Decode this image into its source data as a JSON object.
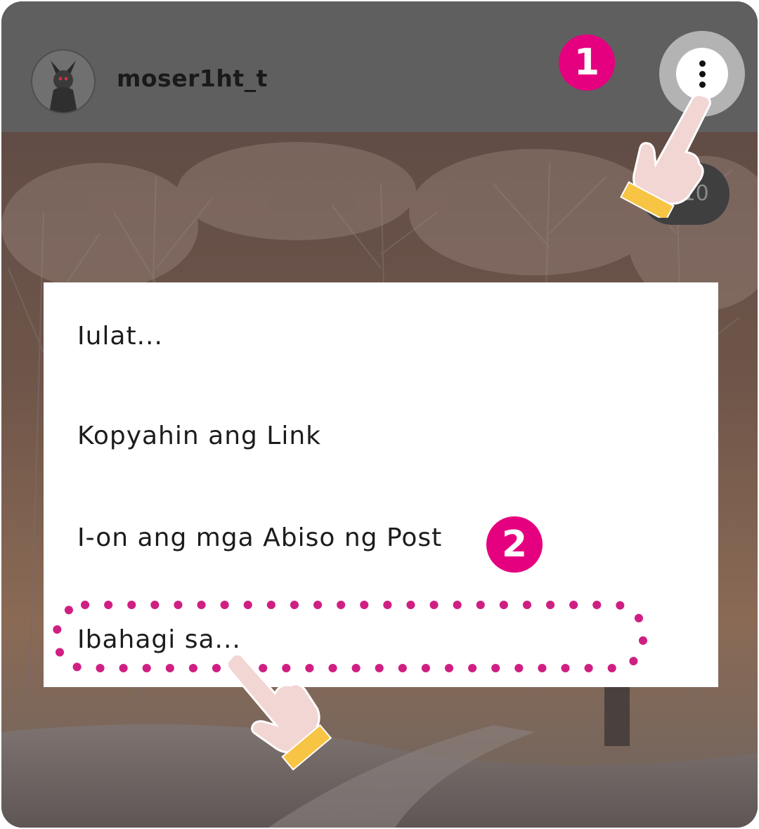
{
  "post": {
    "username": "moser1ht_t",
    "image_counter": "1/10"
  },
  "menu": {
    "items": [
      {
        "label": "Iulat..."
      },
      {
        "label": "Kopyahin ang Link"
      },
      {
        "label": "I-on ang mga Abiso ng Post"
      },
      {
        "label": "Ibahagi sa..."
      }
    ]
  },
  "annotations": {
    "step1": "1",
    "step2": "2",
    "accent_color": "#e5007f",
    "highlight_color": "#d01f82"
  },
  "icons": {
    "more": "vertical-dots-icon",
    "pointer": "pointing-hand-icon"
  }
}
